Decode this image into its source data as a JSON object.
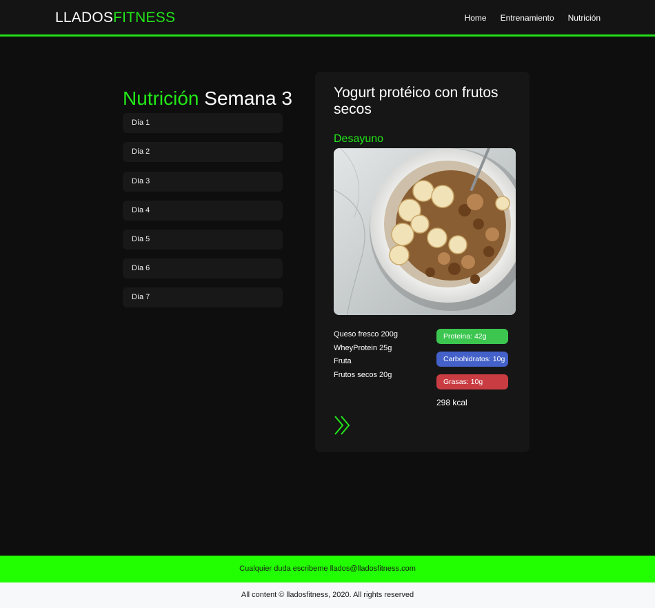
{
  "header": {
    "logo_part1": "LLADOS",
    "logo_part2": "FITNESS",
    "nav": [
      "Home",
      "Entrenamiento",
      "Nutrición"
    ]
  },
  "page_title": {
    "accent": "Nutrición",
    "rest": "Semana 3"
  },
  "days": [
    "Día 1",
    "Día 2",
    "Día 3",
    "Día 4",
    "Día 5",
    "Día 6",
    "Día 7"
  ],
  "recipe": {
    "title": "Yogurt protéico con frutos secos",
    "meal": "Desayuno",
    "image": "bowl-of-yogurt-with-banana-and-nuts",
    "ingredients": [
      "Queso fresco 200g",
      "WheyProtein 25g",
      "Fruta",
      "Frutos secos 20g"
    ],
    "macros": {
      "protein": "Proteina: 42g",
      "carbs": "Carbohidratos: 10g",
      "fat": "Grasas: 10g"
    },
    "kcal": "298 kcal",
    "next_icon": "double-chevron-right-icon"
  },
  "footer": {
    "contact": "Cualquier duda escribeme llados@lladosfitness.com",
    "copyright": "All content © lladosfitness, 2020. All rights reserved"
  },
  "colors": {
    "accent": "#22e818",
    "protein": "#3cc650",
    "carbs": "#4361c9",
    "fat": "#c93d42",
    "footer_green": "#22ff00"
  }
}
